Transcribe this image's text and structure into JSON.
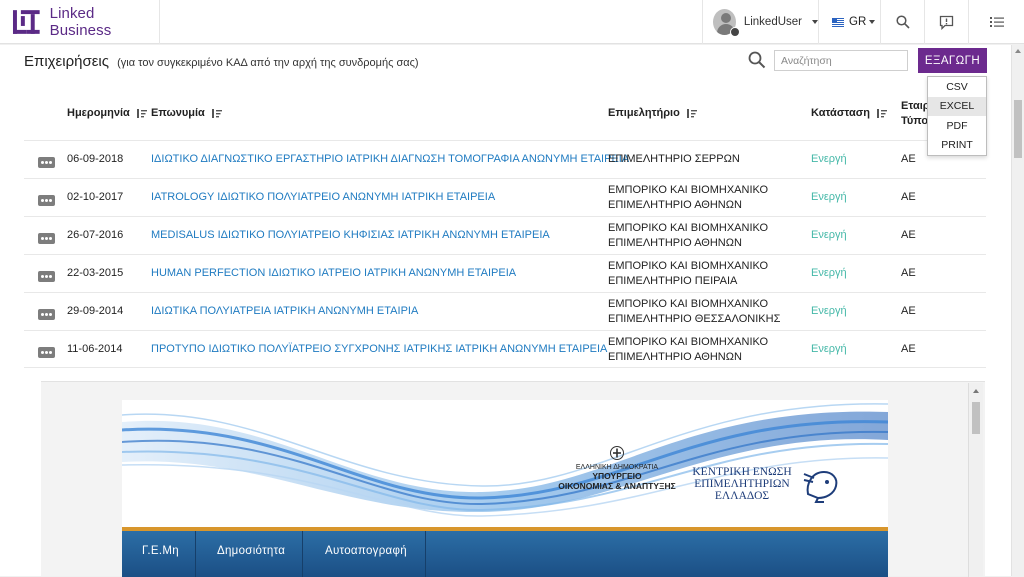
{
  "brand": {
    "name": "Linked Business",
    "logo_icon": "lb-logo-icon",
    "accent": "#5b2a86"
  },
  "header": {
    "user_name": "LinkedUser",
    "language": "GR",
    "icons": [
      "search-icon",
      "feedback-icon",
      "menu-list-icon"
    ]
  },
  "page": {
    "title": "Επιχειρήσεις",
    "subtitle": "(για τον συγκεκριμένο ΚΑΔ από την αρχή της συνδρομής σας)",
    "search_placeholder": "Αναζήτηση",
    "export_label": "ΕΞΑΓΩΓΗ",
    "export_color": "#6c2a8e",
    "export_options": [
      "CSV",
      "EXCEL",
      "PDF",
      "PRINT"
    ],
    "export_highlighted": "EXCEL"
  },
  "table": {
    "columns": {
      "date": "Ημερομηνία",
      "name": "Επωνυμία",
      "chamber": "Επιμελητήριο",
      "status": "Κατάσταση",
      "type_line1": "Εταιρ",
      "type_line2": "Τύπος"
    },
    "rows": [
      {
        "date": "06-09-2018",
        "name": "ΙΔΙΩΤΙΚΟ ΔΙΑΓΝΩΣΤΙΚΟ ΕΡΓΑΣΤΗΡΙΟ ΙΑΤΡΙΚΗ ΔΙΑΓΝΩΣΗ ΤΟΜΟΓΡΑΦΙΑ ΑΝΩΝΥΜΗ ΕΤΑΙΡΕΙΑ",
        "chamber1": "ΕΠΙΜΕΛΗΤΗΡΙΟ ΣΕΡΡΩΝ",
        "chamber2": "",
        "status": "Ενεργή",
        "type": "ΑΕ"
      },
      {
        "date": "02-10-2017",
        "name": "IATROLOGY ΙΔΙΩΤΙΚΟ ΠΟΛΥΙΑΤΡΕΙΟ ΑΝΩΝΥΜΗ ΙΑΤΡΙΚΗ ΕΤΑΙΡΕΙΑ",
        "chamber1": "ΕΜΠΟΡΙΚΟ ΚΑΙ ΒΙΟΜΗΧΑΝΙΚΟ",
        "chamber2": "ΕΠΙΜΕΛΗΤΗΡΙΟ ΑΘΗΝΩΝ",
        "status": "Ενεργή",
        "type": "ΑΕ"
      },
      {
        "date": "26-07-2016",
        "name": "MEDISALUS ΙΔΙΩΤΙΚΟ ΠΟΛΥΙΑΤΡΕΙΟ ΚΗΦΙΣΙΑΣ ΙΑΤΡΙΚΗ ΑΝΩΝΥΜΗ ΕΤΑΙΡΕΙΑ",
        "chamber1": "ΕΜΠΟΡΙΚΟ ΚΑΙ ΒΙΟΜΗΧΑΝΙΚΟ",
        "chamber2": "ΕΠΙΜΕΛΗΤΗΡΙΟ ΑΘΗΝΩΝ",
        "status": "Ενεργή",
        "type": "ΑΕ"
      },
      {
        "date": "22-03-2015",
        "name": "HUMAN PERFECTION ΙΔΙΩΤΙΚΟ ΙΑΤΡΕΙΟ ΙΑΤΡΙΚΗ ΑΝΩΝΥΜΗ ΕΤΑΙΡΕΙΑ",
        "chamber1": "ΕΜΠΟΡΙΚΟ ΚΑΙ ΒΙΟΜΗΧΑΝΙΚΟ",
        "chamber2": "ΕΠΙΜΕΛΗΤΗΡΙΟ ΠΕΙΡΑΙΑ",
        "status": "Ενεργή",
        "type": "ΑΕ"
      },
      {
        "date": "29-09-2014",
        "name": "ΙΔΙΩΤΙΚΑ ΠΟΛΥΙΑΤΡΕΙΑ ΙΑΤΡΙΚΗ ΑΝΩΝΥΜΗ ΕΤΑΙΡΙΑ",
        "chamber1": "ΕΜΠΟΡΙΚΟ ΚΑΙ ΒΙΟΜΗΧΑΝΙΚΟ",
        "chamber2": "ΕΠΙΜΕΛΗΤΗΡΙΟ ΘΕΣΣΑΛΟΝΙΚΗΣ",
        "status": "Ενεργή",
        "type": "ΑΕ"
      },
      {
        "date": "11-06-2014",
        "name": "ΠΡΟΤΥΠΟ ΙΔΙΩΤΙΚΟ ΠΟΛΥΪΑΤΡΕΙΟ ΣΥΓΧΡΟΝΗΣ ΙΑΤΡΙΚΗΣ ΙΑΤΡΙΚΗ ΑΝΩΝΥΜΗ ΕΤΑΙΡΕΙΑ",
        "chamber1": "ΕΜΠΟΡΙΚΟ ΚΑΙ ΒΙΟΜΗΧΑΝΙΚΟ",
        "chamber2": "ΕΠΙΜΕΛΗΤΗΡΙΟ ΑΘΗΝΩΝ",
        "status": "Ενεργή",
        "type": "ΑΕ"
      }
    ],
    "link_color": "#1f7bc1",
    "status_color": "#45b8a8"
  },
  "embed": {
    "ministry_line1": "ΕΛΛΗΝΙΚΗ ΔΗΜΟΚΡΑΤΙΑ",
    "ministry_line2": "ΥΠΟΥΡΓΕΙΟ",
    "ministry_line3": "ΟΙΚΟΝΟΜΙΑΣ & ΑΝΑΠΤΥΞΗΣ",
    "kee_line1": "ΚΕΝΤΡΙΚΗ ΕΝΩΣΗ",
    "kee_line2": "ΕΠΙΜΕΛΗΤΗΡΙΩΝ",
    "kee_line3": "ΕΛΛΑΔΟΣ",
    "nav": [
      "Γ.Ε.Μη",
      "Δημοσιότητα",
      "Αυτοαπογραφή"
    ]
  }
}
